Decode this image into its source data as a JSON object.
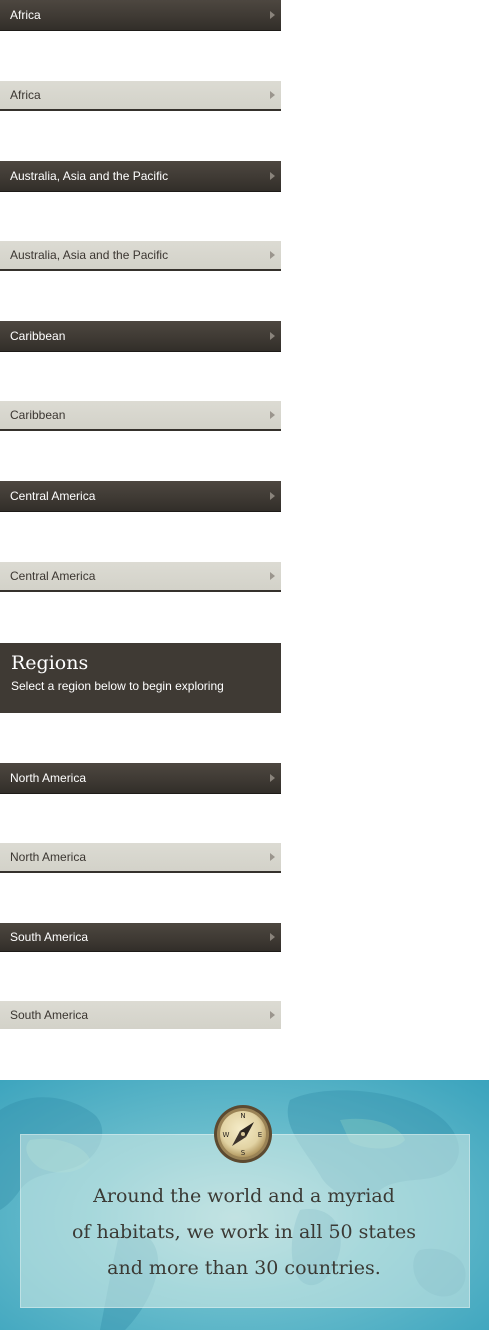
{
  "buttons": [
    {
      "label": "Africa"
    },
    {
      "label": "Africa"
    },
    {
      "label": "Australia, Asia and the Pacific"
    },
    {
      "label": "Australia, Asia and the Pacific"
    },
    {
      "label": "Caribbean"
    },
    {
      "label": "Caribbean"
    },
    {
      "label": "Central America"
    },
    {
      "label": "Central America"
    },
    {
      "label": "North America"
    },
    {
      "label": "North America"
    },
    {
      "label": "South America"
    },
    {
      "label": "South America"
    }
  ],
  "regions": {
    "title": "Regions",
    "subtitle": "Select a region below to begin exploring"
  },
  "banner": {
    "line1": "Around the world and a myriad",
    "line2": "of habitats, we work in all 50 states",
    "line3": "and more than 30 countries.",
    "compass": {
      "n": "N",
      "s": "S",
      "e": "E",
      "w": "W"
    }
  },
  "colors": {
    "dark_button": "#3f3a34",
    "light_button": "#d6d5cc",
    "banner_teal": "#3aa3bd"
  },
  "icons": {
    "arrow": "chevron-right-icon",
    "compass": "compass-icon"
  }
}
